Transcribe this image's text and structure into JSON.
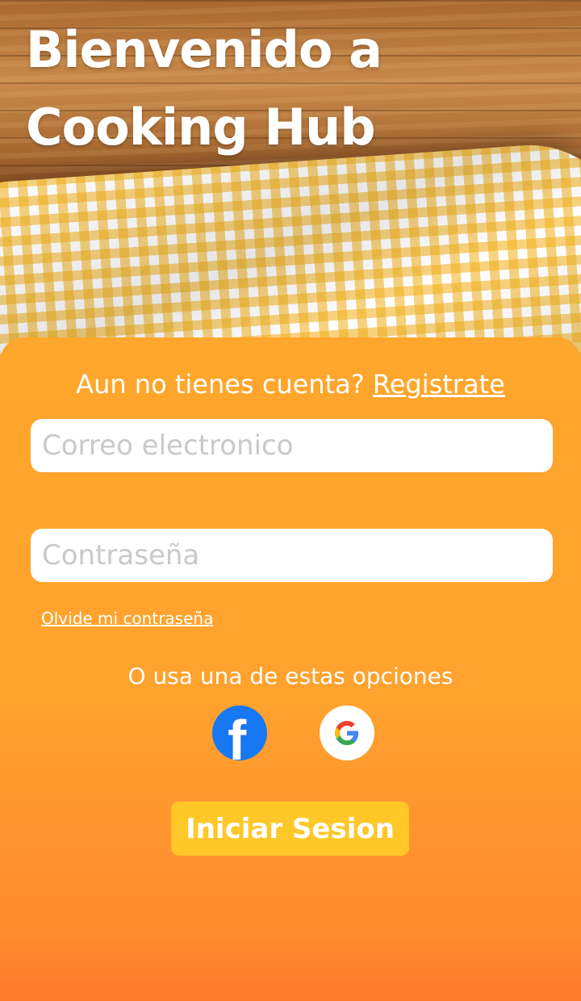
{
  "hero": {
    "title_line1": "Bienvenido a",
    "title_line2": "Cooking Hub"
  },
  "signup": {
    "prompt": "Aun no tienes cuenta?",
    "link": "Registrate"
  },
  "form": {
    "email_placeholder": "Correo electronico",
    "password_placeholder": "Contraseña",
    "forgot_label": "Olvide mi contraseña"
  },
  "social": {
    "prompt": "O usa una de estas opciones",
    "providers": [
      {
        "name": "facebook",
        "icon": "facebook-icon",
        "color": "#1877f2"
      },
      {
        "name": "google",
        "icon": "google-icon"
      }
    ]
  },
  "actions": {
    "login_label": "Iniciar Sesion"
  },
  "colors": {
    "card_top": "#ffa62c",
    "card_bottom": "#ff7a2c",
    "button": "#ffc727",
    "text": "#ffffff"
  }
}
